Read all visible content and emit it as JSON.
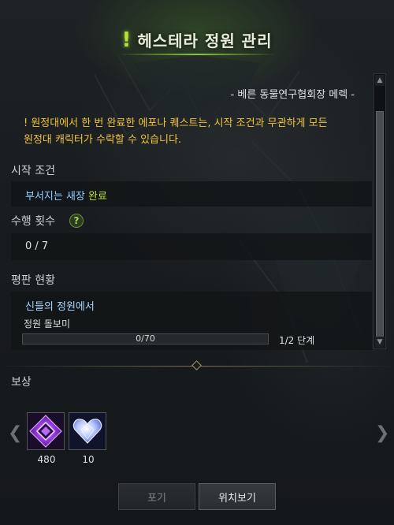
{
  "title": {
    "icon": "!",
    "text": "헤스테라 정원 관리"
  },
  "npc_line": "- 베른 동물연구협회장 메렉 -",
  "notice": {
    "line1": "! 원정대에서 한 번 완료한 에포나 퀘스트는, 시작 조건과 무관하게 모든",
    "line2": "원정대 캐릭터가 수락할 수 있습니다."
  },
  "start_condition": {
    "label": "시작 조건",
    "quest_name": "부서지는 새장",
    "status": "완료"
  },
  "completion_count": {
    "label": "수행 횟수",
    "help": "?",
    "value": "0 / 7"
  },
  "reputation": {
    "label": "평판 현황",
    "faction": "신들의 정원에서",
    "item_name": "정원 돌보미",
    "progress_text": "0/70",
    "progress_fraction": 0,
    "stage": "1/2 단계"
  },
  "rewards": {
    "label": "보상",
    "items": [
      {
        "icon": "purple-gem-icon",
        "quantity": "480"
      },
      {
        "icon": "heart-crystal-icon",
        "quantity": "10"
      }
    ]
  },
  "buttons": {
    "give_up": "포기",
    "locate": "위치보기"
  },
  "colors": {
    "notice": "#f2c43a",
    "quest_name": "#8fd0ff",
    "status_done": "#b8e23a",
    "title_accent": "#b8e23a"
  }
}
